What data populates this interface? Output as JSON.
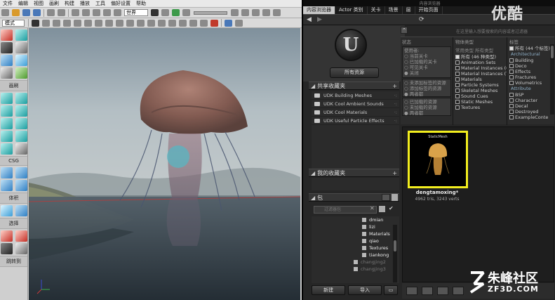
{
  "editor": {
    "menu": [
      "文件",
      "编辑",
      "视图",
      "画刷",
      "构建",
      "播放",
      "工具",
      "偏好设置",
      "帮助"
    ],
    "world_select": "世界",
    "mode_select": "模式",
    "panel_labels": {
      "brush": "画刷",
      "csg": "CSG",
      "volume": "体积",
      "select": "选择",
      "goto": "跳转到"
    }
  },
  "browser": {
    "window_title": "内容浏览器",
    "tabs": [
      "内容浏览器",
      "Actor 类别",
      "关卡",
      "场景",
      "层",
      "开始页面"
    ],
    "search_hint": "在这里输入想要搜索的内容或者过滤器",
    "all_assets_button": "所有资源",
    "logo_letter": "U",
    "filters": {
      "status": {
        "header": "状态",
        "usage_header": "使用者:",
        "radios": [
          "当前关卡",
          "已加载的关卡",
          "可见关卡",
          "关闭"
        ],
        "bottom_radios": [
          "未添加标签的资源",
          "添加标签的资源",
          "两者都"
        ],
        "bottom_radios2": [
          "已加载的资源",
          "未加载的资源",
          "两者都"
        ]
      },
      "object_type": {
        "header": "物体类型",
        "sub_header": [
          "常用类型",
          "所有类型"
        ],
        "items": [
          {
            "label": "所有 (46 种类型)",
            "checked": true
          },
          {
            "label": "Animation Sets",
            "checked": false
          },
          {
            "label": "Material Instances (C",
            "checked": false
          },
          {
            "label": "Material Instances (T",
            "checked": false
          },
          {
            "label": "Materials",
            "checked": false
          },
          {
            "label": "Particle Systems",
            "checked": false
          },
          {
            "label": "Skeletal Meshes",
            "checked": false
          },
          {
            "label": "Sound Cues",
            "checked": false
          },
          {
            "label": "Static Meshes",
            "checked": false
          },
          {
            "label": "Textures",
            "checked": false
          }
        ]
      },
      "tags": {
        "header": "标签",
        "all_item": "所有 (44 个标签)",
        "groups": [
          {
            "name": "Architectural",
            "items": [
              "Building",
              "Deco",
              "Effects",
              "Fractures",
              "Volumetrics"
            ]
          },
          {
            "name": "Attribute",
            "items": [
              "BSP",
              "Character",
              "Decal",
              "Destroyed",
              "ExampleConte"
            ]
          }
        ]
      }
    },
    "shared_collections": {
      "title": "共享收藏夹",
      "items": [
        "UDK Building Meshes",
        "UDK Cool Ambient Sounds",
        "UDK Cool Materials",
        "UDK Useful Particle Effects"
      ]
    },
    "my_collections": {
      "title": "我的收藏夹"
    },
    "packages": {
      "title": "包",
      "search_placeholder": "过滤器包",
      "tree": [
        {
          "label": "dmian",
          "dim": false
        },
        {
          "label": "lizi",
          "dim": false
        },
        {
          "label": "Materials",
          "dim": false
        },
        {
          "label": "qiao",
          "dim": false
        },
        {
          "label": "Textures",
          "dim": false
        },
        {
          "label": "tiankong",
          "dim": false
        },
        {
          "label": "changjing2",
          "dim": true
        },
        {
          "label": "changjing3",
          "dim": true
        }
      ]
    },
    "buttons": {
      "new": "新建",
      "import": "导入"
    },
    "asset": {
      "type": "StaticMesh",
      "name": "dengtamoxing*",
      "stats": "4962 tris, 3243 verts"
    }
  },
  "watermark": {
    "top": "优酷",
    "brand": "朱峰社区",
    "domain": "ZF3D.COM"
  }
}
